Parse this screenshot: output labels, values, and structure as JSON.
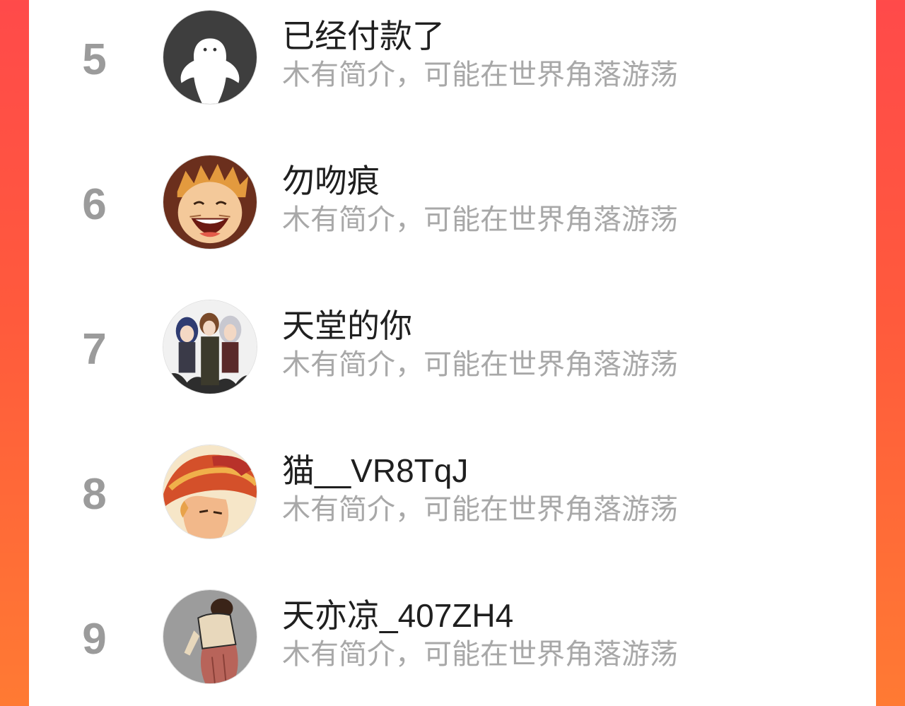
{
  "colors": {
    "background_top": "#ff4a4a",
    "background_bottom": "#ff7a33",
    "rank_color": "#9b9b9b",
    "name_color": "#1f1f1f",
    "bio_color": "#a8a8a8"
  },
  "ranking_list": [
    {
      "rank": "5",
      "name": "已经付款了",
      "bio": "木有简介，可能在世界角落游荡",
      "avatar": "ghost-avatar-icon"
    },
    {
      "rank": "6",
      "name": "勿吻痕",
      "bio": "木有简介，可能在世界角落游荡",
      "avatar": "anime-boy-avatar"
    },
    {
      "rank": "7",
      "name": "天堂的你",
      "bio": "木有简介，可能在世界角落游荡",
      "avatar": "anime-group-avatar"
    },
    {
      "rank": "8",
      "name": "猫__VR8TqJ",
      "bio": "木有简介，可能在世界角落游荡",
      "avatar": "straw-hat-avatar"
    },
    {
      "rank": "9",
      "name": "天亦凉_407ZH4",
      "bio": "木有简介，可能在世界角落游荡",
      "avatar": "cartoon-man-avatar"
    }
  ]
}
